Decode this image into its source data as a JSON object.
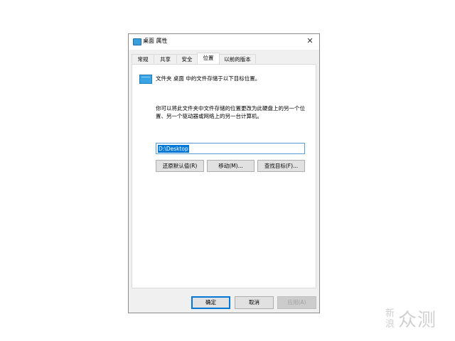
{
  "window": {
    "title": "桌面 属性",
    "close_glyph": "✕"
  },
  "tabs": [
    {
      "label": "常规"
    },
    {
      "label": "共享"
    },
    {
      "label": "安全"
    },
    {
      "label": "位置",
      "active": true
    },
    {
      "label": "以前的版本"
    }
  ],
  "location": {
    "description": "文件夹 桌面 中的文件存储于以下目标位置。",
    "explanation": "你可以将此文件夹中文件存储的位置更改为此硬盘上的另一个位置、另一个驱动器或网络上的另一台计算机。",
    "path_value": "D:\\Desktop",
    "restore_default_label": "还原默认值(R)",
    "move_label": "移动(M)...",
    "find_target_label": "查找目标(F)..."
  },
  "footer": {
    "ok_label": "确定",
    "cancel_label": "取消",
    "apply_label": "应用(A)"
  },
  "watermark": {
    "small_text": "新浪",
    "big_text": "众测"
  },
  "colors": {
    "accent": "#0078d7",
    "folder": "#3aa3e3"
  },
  "icons": {
    "title": "folder-icon",
    "close": "close-icon",
    "location": "folder-icon"
  }
}
